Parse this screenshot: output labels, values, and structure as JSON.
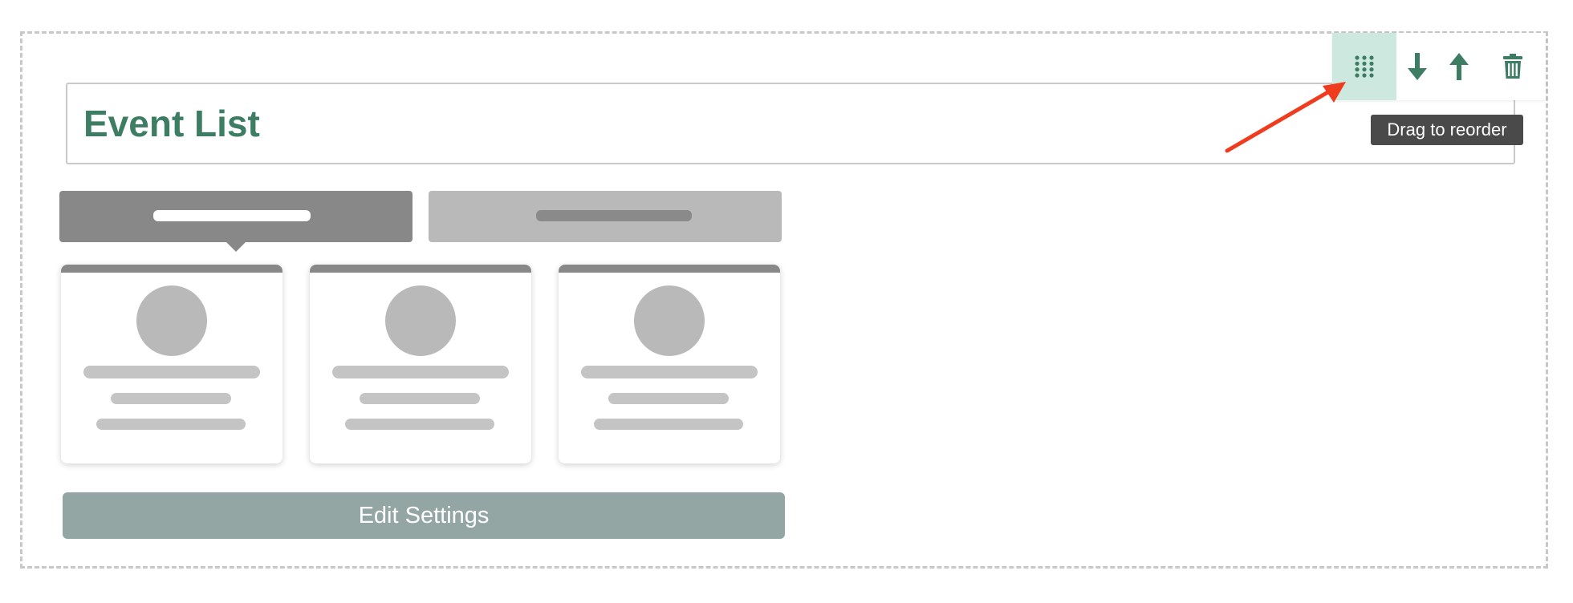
{
  "block": {
    "title": "Event List"
  },
  "toolbar": {
    "tooltip": "Drag to reorder",
    "icons": {
      "drag": "drag-grid-icon",
      "down": "arrow-down-icon",
      "up": "arrow-up-icon",
      "delete": "trash-icon"
    }
  },
  "settings": {
    "edit_label": "Edit Settings"
  },
  "colors": {
    "accent": "#3c7d63",
    "drag_bg": "#cde8df",
    "annotation": "#f03c1e",
    "button_bg": "#94a6a4"
  }
}
